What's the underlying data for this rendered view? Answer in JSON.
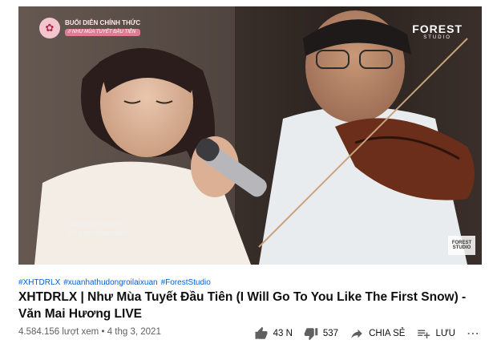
{
  "player": {
    "overlay_title": "BUỔI DIỄN CHÍNH THỨC",
    "overlay_subtitle": "// NHƯ MÙA TUYẾT ĐẦU TIÊN",
    "brand_name": "FOREST",
    "brand_sub": "STUDIO",
    "lyrics_line1": "Chắc là tuyết đang rơi",
    "lyrics_line2": "Khi lá thư đã tan khắp lối"
  },
  "hashtags": [
    "#XHTDRLX",
    "#xuanhathudongroilaixuan",
    "#ForestStudio"
  ],
  "video": {
    "title": "XHTDRLX | Như Mùa Tuyết Đầu Tiên (I Will Go To You Like The First Snow) - Văn Mai Hương LIVE",
    "views": "4.584.156 lượt xem",
    "separator": "•",
    "date": "4 thg 3, 2021"
  },
  "actions": {
    "like_count": "43 N",
    "dislike_count": "537",
    "share_label": "CHIA SẺ",
    "save_label": "LƯU",
    "more_label": "⋯"
  },
  "colors": {
    "link": "#065fd4",
    "title": "#0f0f0f",
    "meta": "#606060",
    "accent_pink": "#e07c93"
  }
}
